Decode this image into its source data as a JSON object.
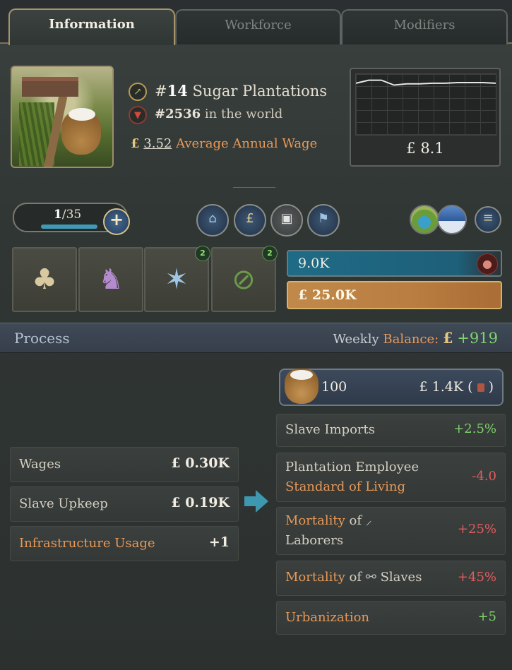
{
  "tabs": [
    {
      "label": "Information",
      "active": true
    },
    {
      "label": "Workforce",
      "active": false
    },
    {
      "label": "Modifiers",
      "active": false
    }
  ],
  "header": {
    "rank_prefix": "#",
    "rank": "14",
    "building_name": "Sugar Plantations",
    "world_rank": "#2536",
    "world_suffix": "in the world",
    "wage_currency": "£",
    "wage_value": "3.52",
    "wage_label": "Average Annual Wage",
    "graph_value": "£ 8.1",
    "graph_series": [
      0.15,
      0.1,
      0.1,
      0.18,
      0.16,
      0.16,
      0.15,
      0.15,
      0.14,
      0.14,
      0.14,
      0.15
    ]
  },
  "level": {
    "current": "1",
    "separator": "/",
    "max": "35"
  },
  "actions": {
    "icons": [
      "house-plus-icon",
      "pound-plus-icon",
      "building-icon",
      "flag-icon"
    ],
    "resources": [
      "grassland-icon",
      "mountain-icon"
    ],
    "menu": "menu-icon"
  },
  "methods": [
    {
      "name": "crops-method-icon",
      "badge": ""
    },
    {
      "name": "ox-press-method-icon",
      "badge": ""
    },
    {
      "name": "whip-laborers-method-icon",
      "badge": "2"
    },
    {
      "name": "no-rail-method-icon",
      "badge": "2"
    }
  ],
  "employment_bar": {
    "value": "9.0K",
    "fill": 0.88
  },
  "cash_bar": {
    "value": "£ 25.0K"
  },
  "process": {
    "title": "Process",
    "weekly_label": "Weekly",
    "balance_label": "Balance:",
    "currency": "£",
    "balance_value": "+919"
  },
  "inputs": [
    {
      "label": "Wages",
      "value": "£ 0.30K",
      "orange": false
    },
    {
      "label": "Slave Upkeep",
      "value": "£ 0.19K",
      "orange": false
    },
    {
      "label": "Infrastructure Usage",
      "value": "+1",
      "orange": true
    }
  ],
  "output": {
    "quantity": "100",
    "price": "£ 1.4K (",
    "price_end": ")"
  },
  "effects": {
    "slave_imports": {
      "label": "Slave Imports",
      "value": "+2.5%"
    },
    "sol": {
      "line1": "Plantation Employee",
      "line2": "Standard of Living",
      "value": "-4.0"
    },
    "mort_laborers": {
      "part1": "Mortality",
      "part2": "of",
      "line2": "Laborers",
      "value": "+25%"
    },
    "mort_slaves": {
      "part1": "Mortality",
      "part2": "of",
      "part3": "Slaves",
      "value": "+45%"
    },
    "urbanization": {
      "label": "Urbanization",
      "value": "+5"
    }
  }
}
